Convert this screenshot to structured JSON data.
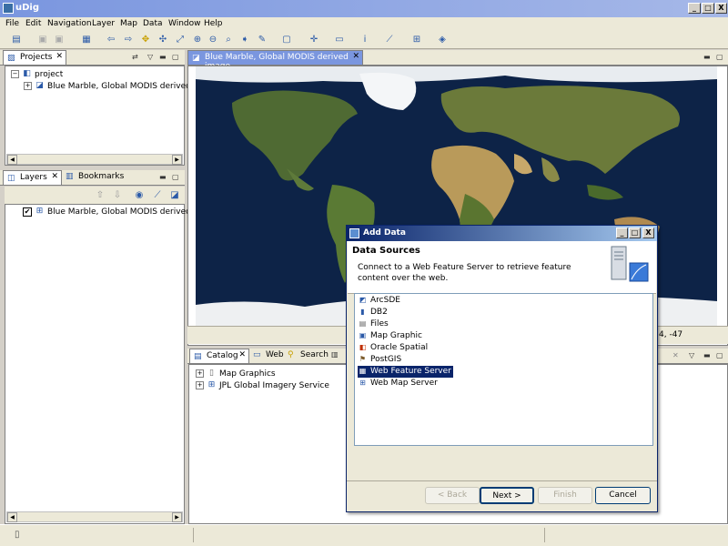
{
  "window": {
    "title": "uDig",
    "min": "_",
    "max": "□",
    "close": "X"
  },
  "menu": [
    "File",
    "Edit",
    "Navigation",
    "Layer",
    "Map",
    "Data",
    "Window",
    "Help"
  ],
  "projects_view": {
    "tab": "Projects",
    "tree": [
      {
        "label": "project"
      },
      {
        "label": "Blue Marble, Global MODIS derived ima"
      }
    ]
  },
  "layers_view": {
    "tabs": [
      "Layers",
      "Bookmarks"
    ],
    "layer": {
      "label": "Blue Marble, Global MODIS derived imag",
      "checked": true
    }
  },
  "map_editor": {
    "tab": "Blue Marble, Global MODIS derived image",
    "coords": "4, -47"
  },
  "catalog_view": {
    "tabs": [
      "Catalog",
      "Web",
      "Search"
    ],
    "tree": [
      "Map Graphics",
      "JPL Global Imagery Service"
    ]
  },
  "dialog": {
    "title": "Add Data",
    "header": "Data Sources",
    "description": "Connect to a Web Feature Server to retrieve feature content over the web.",
    "sources": [
      {
        "label": "ArcSDE",
        "icon": "arcsde-icon"
      },
      {
        "label": "DB2",
        "icon": "database-icon"
      },
      {
        "label": "Files",
        "icon": "files-icon"
      },
      {
        "label": "Map Graphic",
        "icon": "map-graphic-icon"
      },
      {
        "label": "Oracle Spatial",
        "icon": "oracle-icon"
      },
      {
        "label": "PostGIS",
        "icon": "postgis-icon"
      },
      {
        "label": "Web Feature Server",
        "icon": "wfs-icon",
        "selected": true
      },
      {
        "label": "Web Map Server",
        "icon": "wms-icon"
      }
    ],
    "buttons": {
      "back": "< Back",
      "next": "Next >",
      "finish": "Finish",
      "cancel": "Cancel"
    }
  },
  "colors": {
    "selection": "#0a246a",
    "title_gradient_start": "#7a96df",
    "dialog_title": "#0a246a"
  }
}
